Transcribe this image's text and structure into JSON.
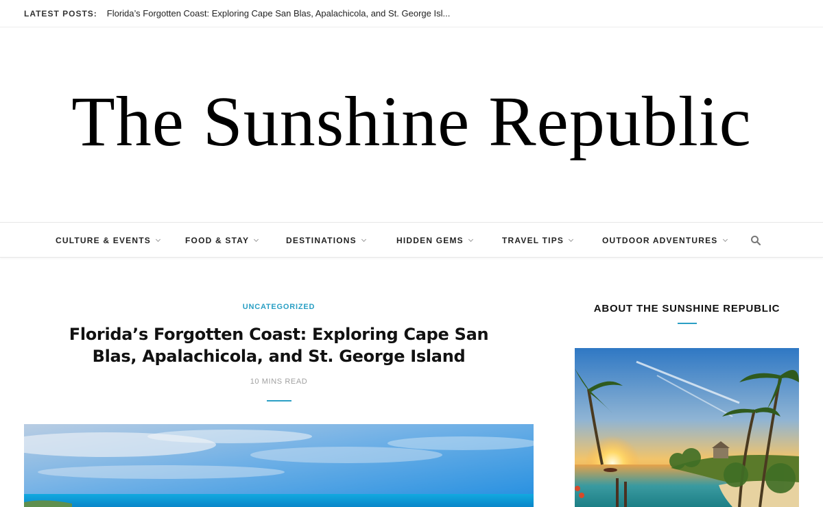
{
  "topbar": {
    "label": "LATEST POSTS:",
    "ticker": "Florida’s Forgotten Coast: Exploring Cape San Blas, Apalachicola, and St. George Isl..."
  },
  "site": {
    "title": "The Sunshine Republic"
  },
  "nav": {
    "items": [
      {
        "label": "CULTURE & EVENTS"
      },
      {
        "label": "FOOD & STAY"
      },
      {
        "label": "DESTINATIONS"
      },
      {
        "label": "HIDDEN GEMS"
      },
      {
        "label": "TRAVEL TIPS"
      },
      {
        "label": "OUTDOOR ADVENTURES"
      }
    ],
    "search_icon": "search-icon"
  },
  "post": {
    "category": "UNCATEGORIZED",
    "title": "Florida’s Forgotten Coast: Exploring Cape San Blas, Apalachicola, and St. George Island",
    "read_time": "10 MINS READ"
  },
  "sidebar": {
    "widget_title": "ABOUT THE SUNSHINE REPUBLIC"
  },
  "colors": {
    "accent": "#2a9fc4",
    "text": "#111111",
    "muted": "#a0a0a0"
  }
}
